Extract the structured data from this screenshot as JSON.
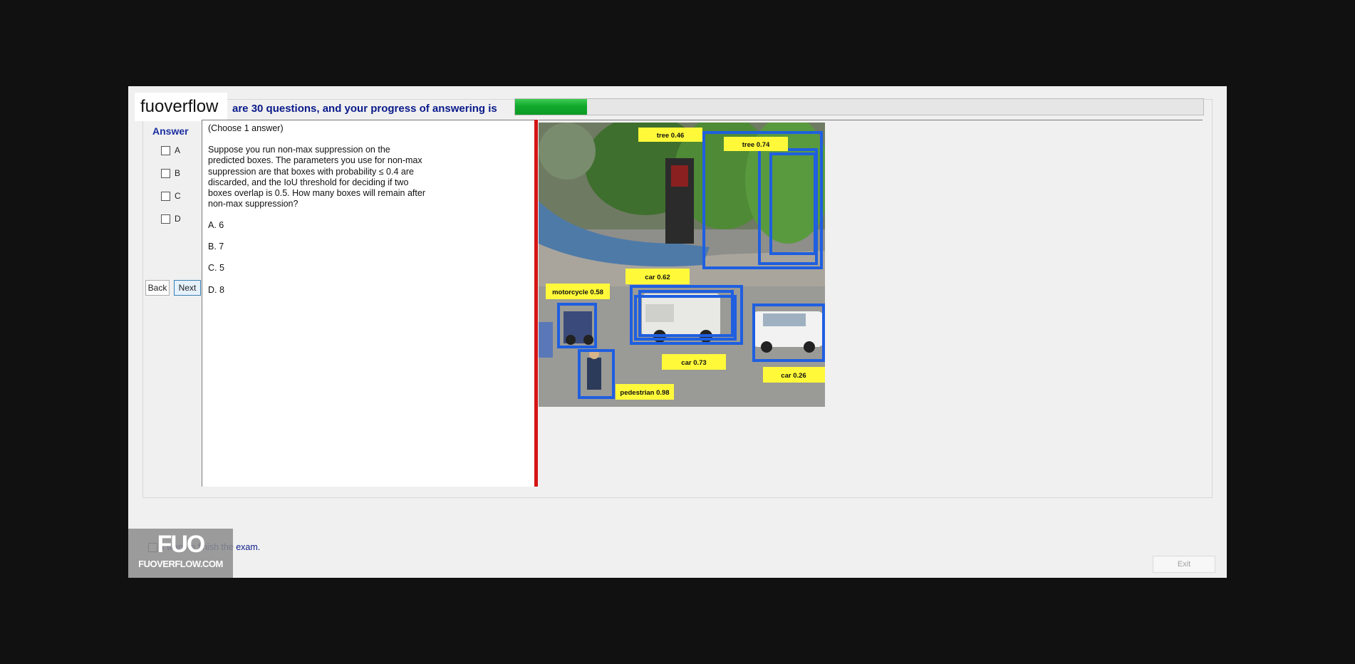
{
  "header": {
    "title": "are 30 questions, and your progress of answering is",
    "progress_fraction": 0.105
  },
  "logo": {
    "text": "fuoverflow"
  },
  "answer_panel": {
    "label": "Answer",
    "choices": [
      "A",
      "B",
      "C",
      "D"
    ],
    "back_label": "Back",
    "next_label": "Next"
  },
  "question": {
    "instruction": "(Choose 1 answer)",
    "text": "Suppose you run non-max suppression on the\npredicted boxes. The parameters you use for non-max\nsuppression are that boxes with probability ≤ 0.4 are\ndiscarded, and the IoU threshold for deciding if two\nboxes overlap is 0.5. How many boxes will remain after\nnon-max suppression?",
    "options": [
      "A.  6",
      "B.  7",
      "C.  5",
      "D.  8"
    ]
  },
  "image": {
    "labels": {
      "tree1": "tree 0.46",
      "tree2": "tree 0.74",
      "car1": "car  0.62",
      "motorcycle": "motorcycle  0.58",
      "car2": "car  0.73",
      "car3": "car 0.26",
      "pedestrian": "pedestrian 0.98"
    },
    "box_color": "#1f5fe0",
    "label_color": "#fff93a"
  },
  "footer": {
    "finish_text": "I want to finish the exam.",
    "exit_label": "Exit"
  },
  "watermark": {
    "big": "FUO",
    "small": "FUOVERFLOW.COM"
  },
  "colors": {
    "progress": "#14aa2e",
    "header_text": "#0a1a8a",
    "divider": "#d41414"
  }
}
